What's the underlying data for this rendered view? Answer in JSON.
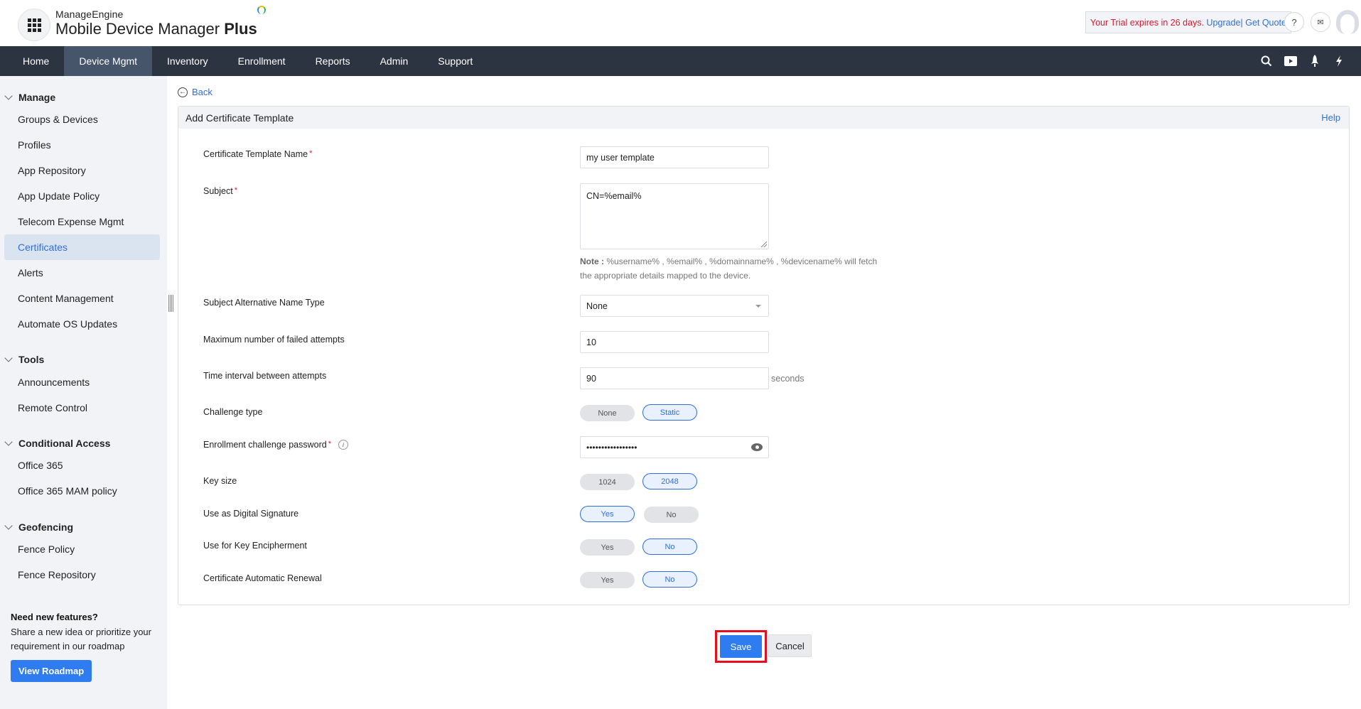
{
  "header": {
    "company": "ManageEngine",
    "product_light": "Mobile Device Manager",
    "product_bold": "Plus",
    "trial_text": "Your Trial expires in 26 days.",
    "upgrade_link": "Upgrade|",
    "quote_link": "Get Quote",
    "help_icon": "?",
    "mail_icon": "✉"
  },
  "nav": {
    "items": [
      {
        "label": "Home"
      },
      {
        "label": "Device Mgmt",
        "active": true
      },
      {
        "label": "Inventory"
      },
      {
        "label": "Enrollment"
      },
      {
        "label": "Reports"
      },
      {
        "label": "Admin"
      },
      {
        "label": "Support"
      }
    ],
    "icons": [
      "search-icon",
      "video-icon",
      "rocket-icon",
      "lightning-icon"
    ]
  },
  "sidebar": {
    "sections": [
      {
        "title": "Manage",
        "items": [
          "Groups & Devices",
          "Profiles",
          "App Repository",
          "App Update Policy",
          "Telecom Expense Mgmt",
          "Certificates",
          "Alerts",
          "Content Management",
          "Automate OS Updates"
        ]
      },
      {
        "title": "Tools",
        "items": [
          "Announcements",
          "Remote Control"
        ]
      },
      {
        "title": "Conditional Access",
        "items": [
          "Office 365",
          "Office 365 MAM policy"
        ]
      },
      {
        "title": "Geofencing",
        "items": [
          "Fence Policy",
          "Fence Repository"
        ]
      }
    ],
    "active_item": "Certificates",
    "roadmap": {
      "title": "Need new features?",
      "desc": "Share a new idea or prioritize your requirement in our roadmap",
      "button": "View Roadmap"
    }
  },
  "main": {
    "back_label": "Back",
    "panel_title": "Add Certificate Template",
    "help_label": "Help",
    "form": {
      "template_name": {
        "label": "Certificate Template Name",
        "value": "my user template"
      },
      "subject": {
        "label": "Subject",
        "value": "CN=%email%"
      },
      "note_label": "Note :",
      "note_text": "%username% , %email% , %domainname% , %devicename% will fetch the appropriate details mapped to the device.",
      "san_type": {
        "label": "Subject Alternative Name Type",
        "value": "None"
      },
      "max_failed": {
        "label": "Maximum number of failed attempts",
        "value": "10"
      },
      "time_interval": {
        "label": "Time interval between attempts",
        "value": "90",
        "suffix": "seconds"
      },
      "challenge_type": {
        "label": "Challenge type",
        "options": [
          "None",
          "Static"
        ],
        "selected": "Static"
      },
      "challenge_password": {
        "label": "Enrollment challenge password",
        "masked_value": "•••••••••••••••••"
      },
      "key_size": {
        "label": "Key size",
        "options": [
          "1024",
          "2048"
        ],
        "selected": "2048"
      },
      "digital_signature": {
        "label": "Use as Digital Signature",
        "options": [
          "Yes",
          "No"
        ],
        "selected": "Yes"
      },
      "key_encipherment": {
        "label": "Use for Key Encipherment",
        "options": [
          "Yes",
          "No"
        ],
        "selected": "No"
      },
      "auto_renewal": {
        "label": "Certificate Automatic Renewal",
        "options": [
          "Yes",
          "No"
        ],
        "selected": "No"
      }
    },
    "save_label": "Save",
    "cancel_label": "Cancel"
  }
}
